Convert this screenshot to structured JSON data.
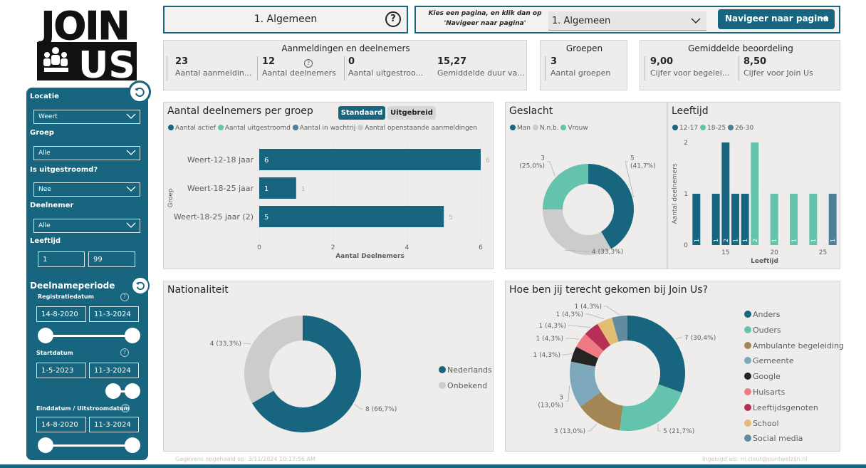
{
  "brand": {
    "logo_top": "JOIN",
    "logo_bottom": "US"
  },
  "colors": {
    "accent": "#17657e",
    "teal_light": "#64c3ac",
    "grey": "#cccccc",
    "slate": "#4f7f95",
    "gold": "#a48555",
    "steel": "#7da8bc",
    "black": "#252423",
    "pink": "#ef7a82",
    "crimson": "#b52f57",
    "yellow": "#e3bd73",
    "blue_grey": "#608ba0"
  },
  "header": {
    "page_title": "1. Algemeen",
    "help": "?",
    "nav_hint_line1": "Kies een pagina, en klik dan op",
    "nav_hint_line2": "'Navigeer naar pagina'",
    "nav_select": "1. Algemeen",
    "nav_button": "Navigeer naar pagina",
    "nav_arrow": "→"
  },
  "kpi_registrations": {
    "title": "Aanmeldingen en deelnemers",
    "items": [
      {
        "value": "23",
        "label": "Aantal aanmeldin..."
      },
      {
        "value": "12",
        "label": "Aantal deelnemers"
      },
      {
        "value": "0",
        "label": "Aantal uitgestroo..."
      },
      {
        "value": "15,27",
        "label": "Gemiddelde duur va..."
      }
    ],
    "help": "?"
  },
  "kpi_groups": {
    "title": "Groepen",
    "value": "3",
    "label": "Aantal groepen"
  },
  "kpi_rating": {
    "title": "Gemiddelde beoordeling",
    "items": [
      {
        "value": "9,00",
        "label": "Cijfer voor begelei..."
      },
      {
        "value": "8,50",
        "label": "Cijfer voor Join Us"
      }
    ]
  },
  "sidebar": {
    "locatie": {
      "label": "Locatie",
      "value": "Weert"
    },
    "groep": {
      "label": "Groep",
      "value": "Alle"
    },
    "uitgestroomd": {
      "label": "Is uitgestroomd?",
      "value": "Nee"
    },
    "deelnemer": {
      "label": "Deelnemer",
      "value": "Alle"
    },
    "leeftijd": {
      "label": "Leeftijd",
      "min": "1",
      "max": "99"
    },
    "periode": {
      "label": "Deelnameperiode"
    },
    "registratie": {
      "label": "Registratiedatum",
      "from": "14-8-2020",
      "to": "11-3-2024",
      "slider_start": 0.0,
      "slider_end": 1.0
    },
    "start": {
      "label": "Startdatum",
      "from": "1-5-2023",
      "to": "11-3-2024",
      "slider_start": 0.78,
      "slider_end": 1.0
    },
    "eind": {
      "label": "Einddatum / Uitstroomdatum",
      "from": "14-8-2020",
      "to": "11-3-2024",
      "slider_start": 0.0,
      "slider_end": 1.0
    },
    "help": "?"
  },
  "groups_chart": {
    "title": "Aantal deelnemers per groep",
    "toggle_standard": "Standaard",
    "toggle_extended": "Uitgebreid",
    "legend": [
      "Aantal actief",
      "Aantal uitgestroomd",
      "Aantal in wachtrij",
      "Aantal openstaande aanmeldingen"
    ],
    "legend_colors": [
      "#17657e",
      "#64c3ac",
      "#4f7f95",
      "#cccccc"
    ]
  },
  "gender_chart": {
    "title": "Geslacht",
    "legend": [
      "Man",
      "N.n.b.",
      "Vrouw"
    ]
  },
  "age_chart": {
    "title": "Leeftijd",
    "legend": [
      "12-17",
      "18-25",
      "26-30"
    ]
  },
  "nationality_chart": {
    "title": "Nationaliteit",
    "legend": [
      "Nederlands",
      "Onbekend"
    ]
  },
  "source_chart": {
    "title": "Hoe ben jij terecht gekomen bij Join Us?",
    "legend": [
      "Anders",
      "Ouders",
      "Ambulante begeleiding",
      "Gemeente",
      "Google",
      "Huisarts",
      "Leeftijdsgenoten",
      "School",
      "Social media"
    ]
  },
  "footer": {
    "refreshed": "Gegevens opgehaald op: 3/11/2024 10:17:56 AM",
    "logged_in": "Ingelogd als: m.clout@puntwelzijn.nl"
  },
  "chart_data": [
    {
      "type": "bar",
      "orientation": "horizontal",
      "title": "Aantal deelnemers per groep",
      "categories": [
        "Weert-12-18 jaar",
        "Weert-18-25 jaar",
        "Weert-18-25 jaar (2)"
      ],
      "series": [
        {
          "name": "Aantal actief",
          "values": [
            6,
            1,
            5
          ]
        }
      ],
      "totals": [
        6,
        1,
        5
      ],
      "xlabel": "Aantal Deelnemers",
      "ylabel": "Groep",
      "xlim": [
        0,
        6
      ],
      "xticks": [
        0,
        2,
        4,
        6
      ]
    },
    {
      "type": "pie",
      "donut": true,
      "title": "Geslacht",
      "labels": [
        "Man",
        "N.n.b.",
        "Vrouw"
      ],
      "values": [
        5,
        4,
        3
      ],
      "data_labels": [
        "5 (41,7%)",
        "4 (33,3%)",
        "3 (25,0%)"
      ],
      "colors": [
        "#17657e",
        "#cccccc",
        "#64c3ac"
      ]
    },
    {
      "type": "bar",
      "title": "Leeftijd",
      "xlabel": "Leeftijd",
      "ylabel": "Aantal deelnemers",
      "xlim": [
        11.5,
        26.5
      ],
      "ylim": [
        0,
        2
      ],
      "xticks": [
        15,
        20,
        25
      ],
      "yticks": [
        0,
        1,
        2
      ],
      "series": [
        {
          "name": "12-17",
          "x": [
            12,
            14,
            15,
            16,
            17
          ],
          "values": [
            1,
            1,
            2,
            1,
            1
          ],
          "labels": [
            "1",
            "1",
            "2",
            "1",
            "1"
          ]
        },
        {
          "name": "18-25",
          "x": [
            18,
            20,
            22,
            24
          ],
          "values": [
            2,
            1,
            1,
            1
          ],
          "labels": [
            "2",
            "1",
            "1",
            "1"
          ]
        },
        {
          "name": "26-30",
          "x": [
            26
          ],
          "values": [
            1
          ],
          "labels": [
            "1"
          ]
        }
      ]
    },
    {
      "type": "pie",
      "donut": true,
      "title": "Nationaliteit",
      "labels": [
        "Nederlands",
        "Onbekend"
      ],
      "values": [
        8,
        4
      ],
      "data_labels": [
        "8 (66,7%)",
        "4 (33,3%)"
      ],
      "colors": [
        "#17657e",
        "#cccccc"
      ]
    },
    {
      "type": "pie",
      "donut": true,
      "title": "Hoe ben jij terecht gekomen bij Join Us?",
      "labels": [
        "Anders",
        "Ouders",
        "Ambulante begeleiding",
        "Gemeente",
        "Google",
        "Huisarts",
        "Leeftijdsgenoten",
        "School",
        "Social media"
      ],
      "values": [
        7,
        5,
        3,
        3,
        1,
        1,
        1,
        1,
        1
      ],
      "data_labels": [
        "7 (30,4%)",
        "5 (21,7%)",
        "3 (13,0%)",
        "3 (13,0%)",
        "1 (4,3%)",
        "1 (4,3%)",
        "1 (4,3%)",
        "1 (4,3%)",
        "1 (4,3%)"
      ],
      "colors": [
        "#17657e",
        "#64c3ac",
        "#a48555",
        "#7da8bc",
        "#252423",
        "#ef7a82",
        "#b52f57",
        "#e3bd73",
        "#608ba0"
      ]
    }
  ]
}
